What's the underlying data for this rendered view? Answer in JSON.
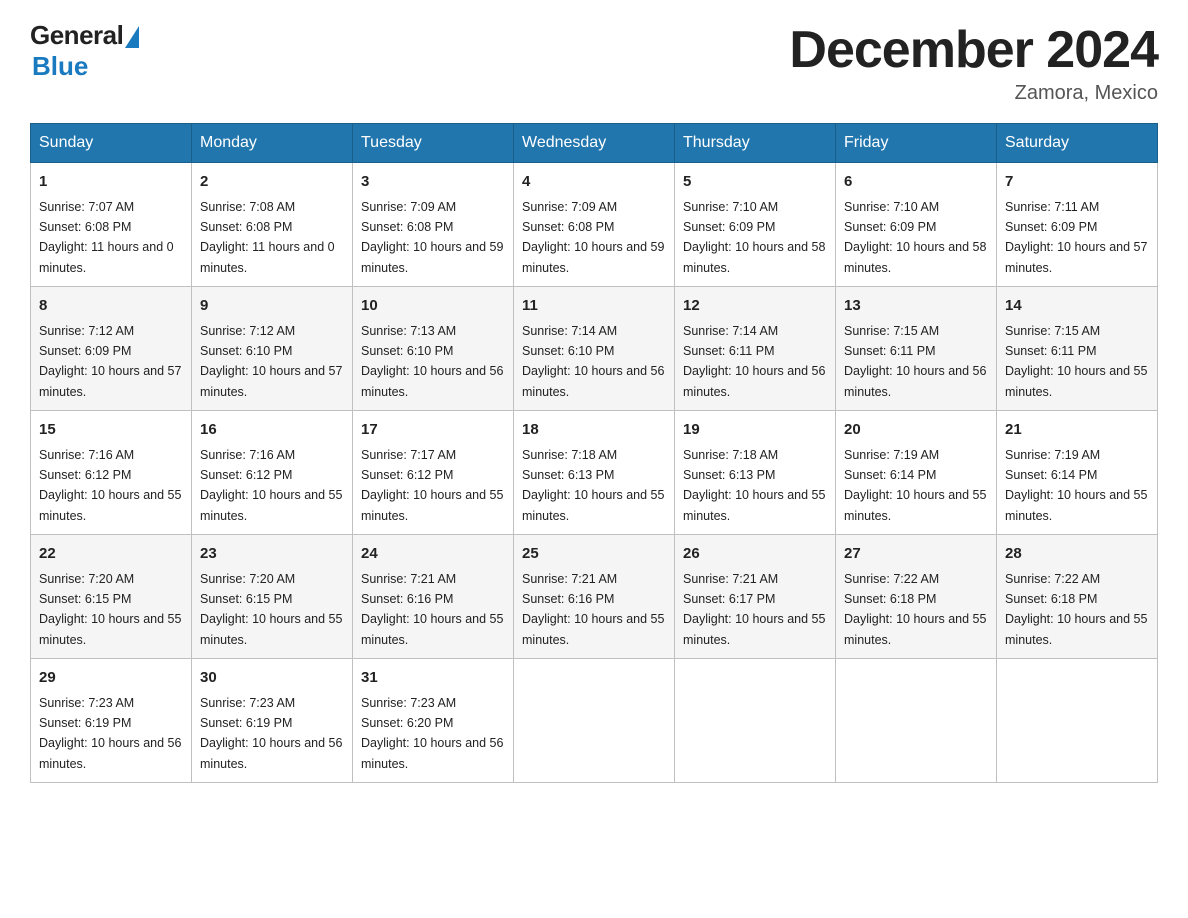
{
  "header": {
    "logo_general": "General",
    "logo_blue": "Blue",
    "month_title": "December 2024",
    "location": "Zamora, Mexico"
  },
  "weekdays": [
    "Sunday",
    "Monday",
    "Tuesday",
    "Wednesday",
    "Thursday",
    "Friday",
    "Saturday"
  ],
  "weeks": [
    [
      {
        "day": "1",
        "sunrise": "7:07 AM",
        "sunset": "6:08 PM",
        "daylight": "11 hours and 0 minutes."
      },
      {
        "day": "2",
        "sunrise": "7:08 AM",
        "sunset": "6:08 PM",
        "daylight": "11 hours and 0 minutes."
      },
      {
        "day": "3",
        "sunrise": "7:09 AM",
        "sunset": "6:08 PM",
        "daylight": "10 hours and 59 minutes."
      },
      {
        "day": "4",
        "sunrise": "7:09 AM",
        "sunset": "6:08 PM",
        "daylight": "10 hours and 59 minutes."
      },
      {
        "day": "5",
        "sunrise": "7:10 AM",
        "sunset": "6:09 PM",
        "daylight": "10 hours and 58 minutes."
      },
      {
        "day": "6",
        "sunrise": "7:10 AM",
        "sunset": "6:09 PM",
        "daylight": "10 hours and 58 minutes."
      },
      {
        "day": "7",
        "sunrise": "7:11 AM",
        "sunset": "6:09 PM",
        "daylight": "10 hours and 57 minutes."
      }
    ],
    [
      {
        "day": "8",
        "sunrise": "7:12 AM",
        "sunset": "6:09 PM",
        "daylight": "10 hours and 57 minutes."
      },
      {
        "day": "9",
        "sunrise": "7:12 AM",
        "sunset": "6:10 PM",
        "daylight": "10 hours and 57 minutes."
      },
      {
        "day": "10",
        "sunrise": "7:13 AM",
        "sunset": "6:10 PM",
        "daylight": "10 hours and 56 minutes."
      },
      {
        "day": "11",
        "sunrise": "7:14 AM",
        "sunset": "6:10 PM",
        "daylight": "10 hours and 56 minutes."
      },
      {
        "day": "12",
        "sunrise": "7:14 AM",
        "sunset": "6:11 PM",
        "daylight": "10 hours and 56 minutes."
      },
      {
        "day": "13",
        "sunrise": "7:15 AM",
        "sunset": "6:11 PM",
        "daylight": "10 hours and 56 minutes."
      },
      {
        "day": "14",
        "sunrise": "7:15 AM",
        "sunset": "6:11 PM",
        "daylight": "10 hours and 55 minutes."
      }
    ],
    [
      {
        "day": "15",
        "sunrise": "7:16 AM",
        "sunset": "6:12 PM",
        "daylight": "10 hours and 55 minutes."
      },
      {
        "day": "16",
        "sunrise": "7:16 AM",
        "sunset": "6:12 PM",
        "daylight": "10 hours and 55 minutes."
      },
      {
        "day": "17",
        "sunrise": "7:17 AM",
        "sunset": "6:12 PM",
        "daylight": "10 hours and 55 minutes."
      },
      {
        "day": "18",
        "sunrise": "7:18 AM",
        "sunset": "6:13 PM",
        "daylight": "10 hours and 55 minutes."
      },
      {
        "day": "19",
        "sunrise": "7:18 AM",
        "sunset": "6:13 PM",
        "daylight": "10 hours and 55 minutes."
      },
      {
        "day": "20",
        "sunrise": "7:19 AM",
        "sunset": "6:14 PM",
        "daylight": "10 hours and 55 minutes."
      },
      {
        "day": "21",
        "sunrise": "7:19 AM",
        "sunset": "6:14 PM",
        "daylight": "10 hours and 55 minutes."
      }
    ],
    [
      {
        "day": "22",
        "sunrise": "7:20 AM",
        "sunset": "6:15 PM",
        "daylight": "10 hours and 55 minutes."
      },
      {
        "day": "23",
        "sunrise": "7:20 AM",
        "sunset": "6:15 PM",
        "daylight": "10 hours and 55 minutes."
      },
      {
        "day": "24",
        "sunrise": "7:21 AM",
        "sunset": "6:16 PM",
        "daylight": "10 hours and 55 minutes."
      },
      {
        "day": "25",
        "sunrise": "7:21 AM",
        "sunset": "6:16 PM",
        "daylight": "10 hours and 55 minutes."
      },
      {
        "day": "26",
        "sunrise": "7:21 AM",
        "sunset": "6:17 PM",
        "daylight": "10 hours and 55 minutes."
      },
      {
        "day": "27",
        "sunrise": "7:22 AM",
        "sunset": "6:18 PM",
        "daylight": "10 hours and 55 minutes."
      },
      {
        "day": "28",
        "sunrise": "7:22 AM",
        "sunset": "6:18 PM",
        "daylight": "10 hours and 55 minutes."
      }
    ],
    [
      {
        "day": "29",
        "sunrise": "7:23 AM",
        "sunset": "6:19 PM",
        "daylight": "10 hours and 56 minutes."
      },
      {
        "day": "30",
        "sunrise": "7:23 AM",
        "sunset": "6:19 PM",
        "daylight": "10 hours and 56 minutes."
      },
      {
        "day": "31",
        "sunrise": "7:23 AM",
        "sunset": "6:20 PM",
        "daylight": "10 hours and 56 minutes."
      },
      null,
      null,
      null,
      null
    ]
  ]
}
